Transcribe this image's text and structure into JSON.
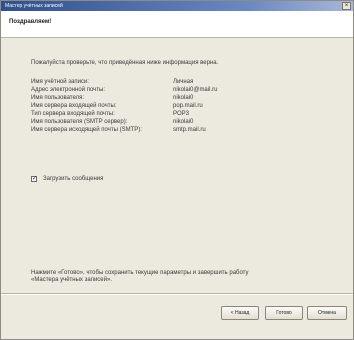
{
  "window": {
    "title": "Мастер учётных записей",
    "close_glyph": "×"
  },
  "header": {
    "title": "Поздравляем!"
  },
  "content": {
    "intro": "Пожалуйста проверьте, что приведённая ниже информация верна.",
    "rows": [
      {
        "label": "Имя учётной записи:",
        "value": "Личная"
      },
      {
        "label": "Адрес электронной почты:",
        "value": "nikolai0@mail.ru"
      },
      {
        "label": "Имя пользователя:",
        "value": "nikolai0"
      },
      {
        "label": "Имя сервера входящей почты:",
        "value": "pop.mail.ru"
      },
      {
        "label": "Тип сервера входящей почты:",
        "value": "POP3"
      },
      {
        "label": "Имя пользователя (SMTP сервер):",
        "value": "nikolai0"
      },
      {
        "label": "Имя сервера исходящей почты (SMTP):",
        "value": "smtp.mail.ru"
      }
    ],
    "checkbox": {
      "label": "Загрузить сообщения",
      "checked": true,
      "check_glyph": "✓"
    },
    "footer_lines": [
      "Нажмите «Готово», чтобы сохранить текущие параметры и завершить работу",
      "«Мастера учётных записей»."
    ]
  },
  "buttons": {
    "back": "< Назад",
    "finish": "Готово",
    "cancel": "Отмена"
  }
}
